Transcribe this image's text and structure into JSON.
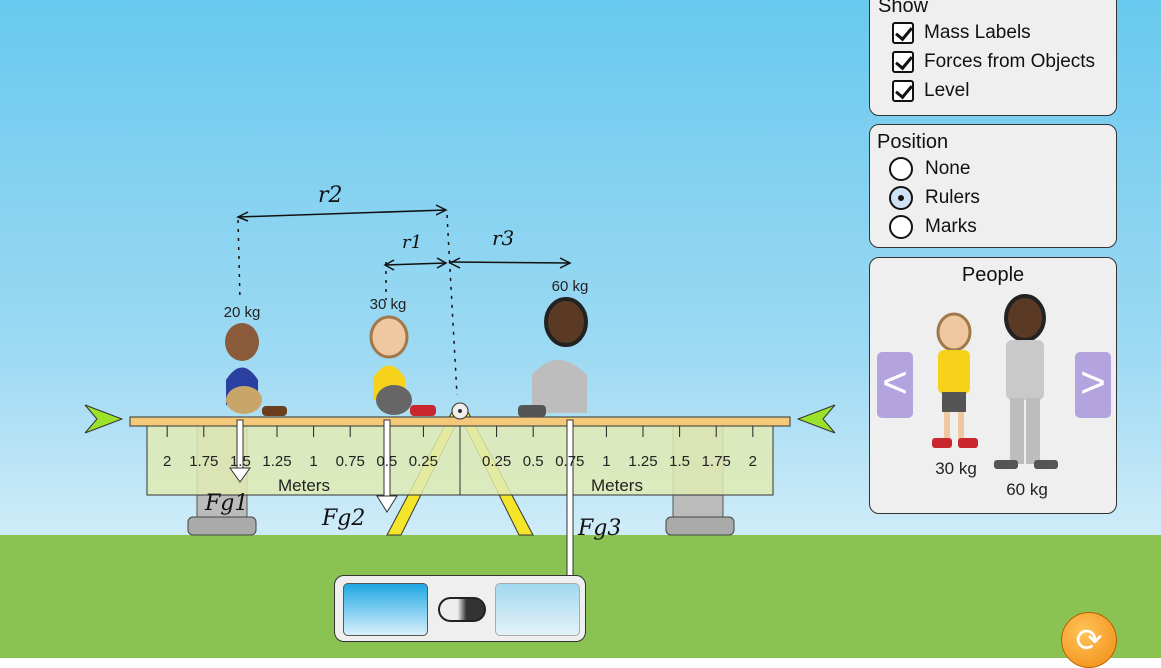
{
  "show_panel": {
    "title": "Show",
    "items": [
      {
        "label": "Mass Labels",
        "checked": true
      },
      {
        "label": "Forces from Objects",
        "checked": true
      },
      {
        "label": "Level",
        "checked": true
      }
    ]
  },
  "position_panel": {
    "title": "Position",
    "options": [
      {
        "label": "None",
        "selected": false
      },
      {
        "label": "Rulers",
        "selected": true
      },
      {
        "label": "Marks",
        "selected": false
      }
    ]
  },
  "people_panel": {
    "title": "People",
    "people": [
      {
        "mass": "30 kg"
      },
      {
        "mass": "60 kg"
      }
    ],
    "prev": "<",
    "next": ">"
  },
  "ruler": {
    "left_ticks": [
      "2",
      "1.75",
      "1.5",
      "1.25",
      "1",
      "0.75",
      "0.5",
      "0.25"
    ],
    "right_ticks": [
      "0.25",
      "0.5",
      "0.75",
      "1",
      "1.25",
      "1.5",
      "1.75",
      "2"
    ],
    "unit": "Meters"
  },
  "masses": [
    {
      "label": "20 kg"
    },
    {
      "label": "30 kg"
    },
    {
      "label": "60 kg"
    }
  ],
  "annotations": {
    "r1": "r1",
    "r2": "r2",
    "r3": "r3",
    "fg1": "Fg1",
    "fg2": "Fg2",
    "fg3": "Fg3"
  },
  "colors": {
    "sky": "#68c9ee",
    "grass": "#8bc353",
    "plank": "#f5c97a",
    "fulcrum": "#f4e52a",
    "nav": "#b3a4e0",
    "reset": "#f39a1e"
  }
}
